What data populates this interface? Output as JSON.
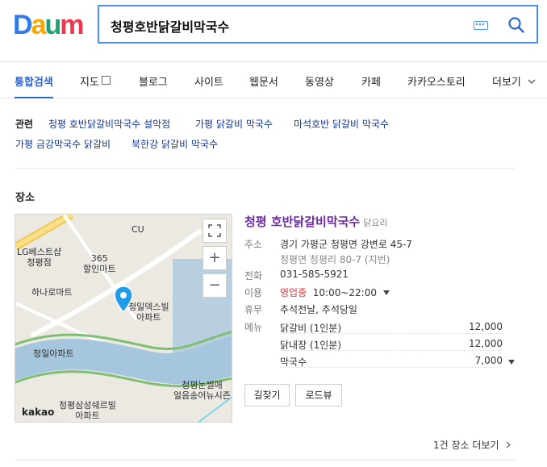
{
  "logo": {
    "letters": [
      "D",
      "a",
      "u",
      "m"
    ],
    "colors": [
      "#2f79e8",
      "#f6a800",
      "#1aa36f",
      "#f0364d"
    ]
  },
  "search": {
    "query": "청평호반닭갈비막국수"
  },
  "tabs": [
    {
      "label": "통합검색",
      "active": true
    },
    {
      "label": "지도"
    },
    {
      "label": "블로그"
    },
    {
      "label": "사이트"
    },
    {
      "label": "웹문서"
    },
    {
      "label": "동영상"
    },
    {
      "label": "카페"
    },
    {
      "label": "카카오스토리"
    },
    {
      "label": "더보기"
    }
  ],
  "related": {
    "label": "관련",
    "items": [
      "청평 호반닭갈비막국수 설악점",
      "가평 닭갈비 막국수",
      "마석호반 닭갈비 막국수",
      "가평 금강막국수 닭갈비",
      "북한강 닭갈비 막국수"
    ]
  },
  "section": {
    "title": "장소"
  },
  "map": {
    "labels": [
      "CU",
      "LG베스트샵\n청평점",
      "365\n할인마트",
      "하나로마트",
      "청일덱스빌\n아파트",
      "청일아파트",
      "청평눈썰매\n얼음송어뉴시즌",
      "청평삼성쉐르빌\n아파트"
    ],
    "brand": "kakao",
    "zoom_in": "+",
    "zoom_out": "−"
  },
  "place": {
    "name": "청평 호반닭갈비막국수",
    "category": "닭요리",
    "rows": {
      "address_label": "주소",
      "address": "경기 가평군 청평면 강변로 45-7",
      "address_lot": "청평면 청평리 80-7 (지번)",
      "phone_label": "전화",
      "phone": "031-585-5921",
      "hours_label": "이용",
      "status": "영업중",
      "hours": "10:00~22:00",
      "closed_label": "휴무",
      "closed": "추석전날, 추석당일",
      "menu_label": "메뉴"
    },
    "menu": [
      {
        "name": "닭갈비 (1인분)",
        "price": "12,000"
      },
      {
        "name": "닭내장 (1인분)",
        "price": "12,000"
      },
      {
        "name": "막국수",
        "price": "7,000"
      }
    ],
    "buttons": {
      "directions": "길찾기",
      "roadview": "로드뷰"
    }
  },
  "footer": {
    "more": "1건 장소 더보기"
  }
}
